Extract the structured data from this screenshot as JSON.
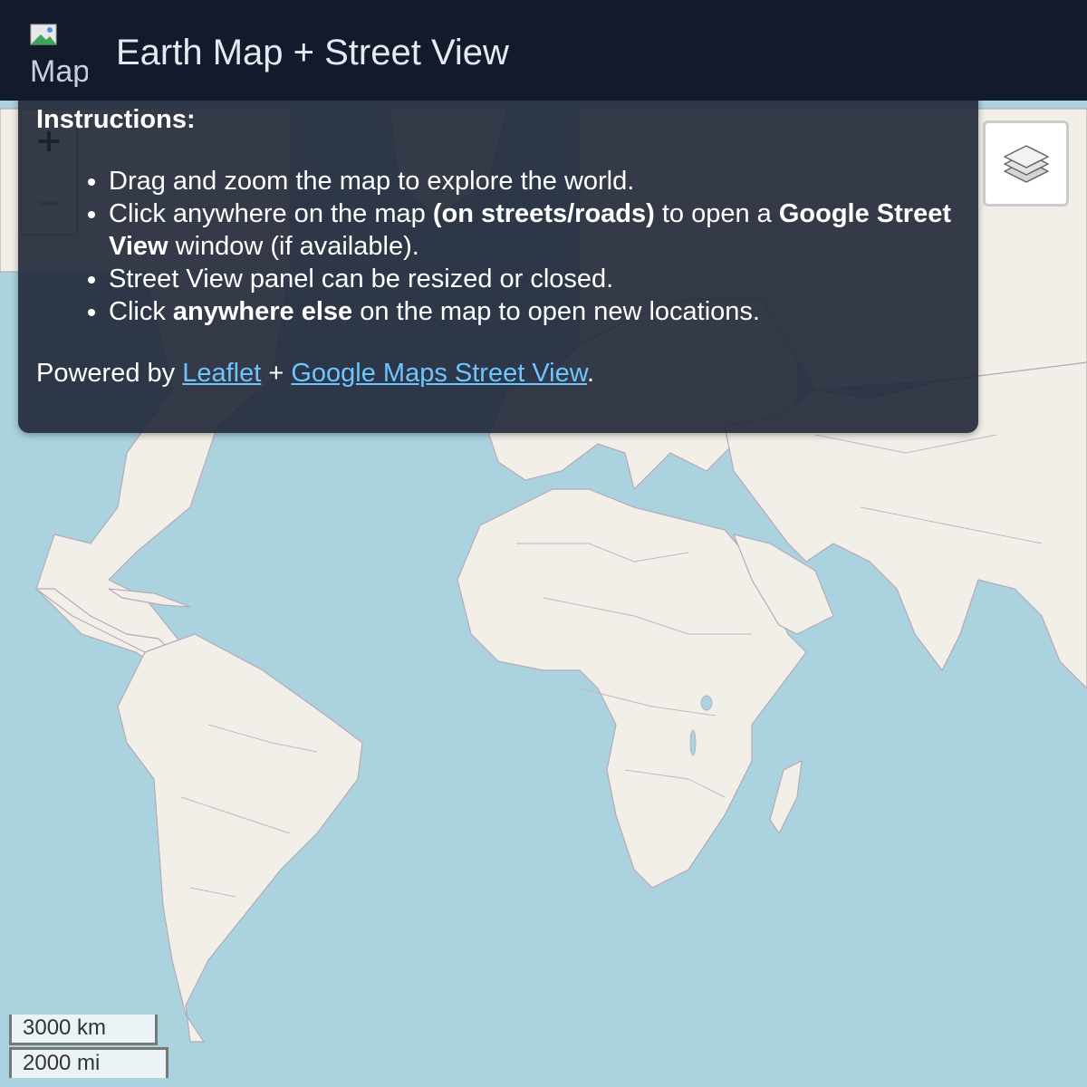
{
  "header": {
    "logo_alt": "Map",
    "title": "Earth Map + Street View"
  },
  "zoom": {
    "in_label": "+",
    "out_label": "−"
  },
  "instructions": {
    "heading": "Instructions:",
    "items": [
      {
        "text": "Drag and zoom the map to explore the world."
      },
      {
        "pre": "Click anywhere on the map ",
        "bold1": "(on streets/roads)",
        "mid": " to open a ",
        "bold2": "Google Street View",
        "post": " window (if available)."
      },
      {
        "text": "Street View panel can be resized or closed."
      },
      {
        "pre": "Click ",
        "bold": "anywhere else",
        "post": " on the map to open new locations."
      }
    ],
    "powered_prefix": "Powered by ",
    "link1": "Leaflet",
    "plus": " + ",
    "link2": "Google Maps Street View",
    "period": "."
  },
  "layers": {
    "icon": "layers-icon"
  },
  "scale": {
    "km": "3000 km",
    "mi": "2000 mi"
  },
  "colors": {
    "header_bg": "#121a2c",
    "overlay_bg": "#202636",
    "link": "#6cc5ff",
    "ocean": "#aad3df",
    "land": "#f2efe9",
    "border": "#b8a9b6"
  }
}
